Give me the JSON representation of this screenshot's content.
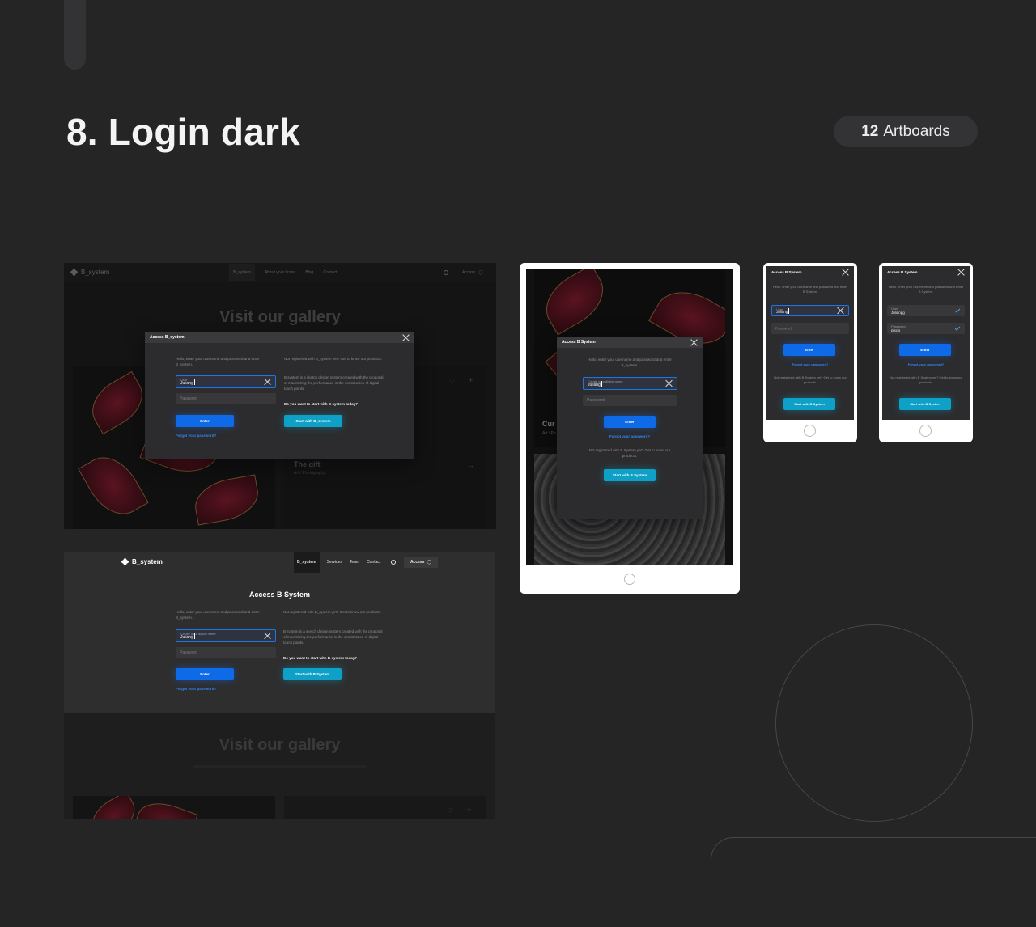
{
  "section": {
    "title": "8. Login dark",
    "badge_count": "12",
    "badge_text": "Artboards"
  },
  "colors": {
    "background": "#252526",
    "primary_blue": "#0f6ae8",
    "teal": "#0ea0c6",
    "link": "#2f86f4"
  },
  "desktop_modal": {
    "brand": "B_system",
    "nav": [
      "B_system",
      "About your brand",
      "Blog",
      "Contact"
    ],
    "nav_access": "Access",
    "hero": "Visit our gallery",
    "card_title": "The gift",
    "card_subtitle": "Art / Photography",
    "modal": {
      "title": "Access B_system",
      "intro": "Hello, enter your username and password and enter B_system.",
      "user_label": "User",
      "user_value": "Juliang",
      "password_placeholder": "Password",
      "enter": "Enter",
      "forgot": "Forgot your password?",
      "register": "Not registered with B_system yet? Get to know our products.",
      "about": "B system is a sketch design system created with the proposal of maximizing the performance in the construction of digital touch points.",
      "question": "Do you want to start with B-system today?",
      "start": "Start with B_system"
    }
  },
  "desktop_page": {
    "brand": "B_system",
    "nav": [
      "B_system",
      "Services",
      "Team",
      "Contact"
    ],
    "nav_access": "Access",
    "title": "Access B System",
    "intro": "Hello, enter your username and password and enter B_system.",
    "user_label": "Create your digital name",
    "user_value": "Juliang",
    "password_placeholder": "Password",
    "enter": "Enter",
    "forgot": "Forgot your password?",
    "register": "Not registered with B_system yet? Get to know our products.",
    "about": "B system is a sketch design system created with the proposal of maximizing the performance in the construction of digital touch points.",
    "question": "Do you want to start with B-system today?",
    "start": "Start with B System",
    "hero": "Visit our gallery"
  },
  "tablet": {
    "card_title": "Cur",
    "card_subtitle": "Art / Ph",
    "modal": {
      "title": "Access B System",
      "intro": "Hello, enter your username and password and enter B_system.",
      "user_label": "Create your digital name",
      "user_value": "Juliang",
      "password_placeholder": "Password",
      "enter": "Enter",
      "forgot": "Forgot your password?",
      "register": "Not registered with B System yet? Get to know our products.",
      "start": "Start with B System"
    }
  },
  "phone1": {
    "title": "Access B System",
    "intro": "Hello, enter your username and password and enter B System.",
    "user_label": "User",
    "user_value": "Juliang",
    "password_placeholder": "Password",
    "enter": "Enter",
    "forgot": "Forgot your password?",
    "register": "Not registered with B System yet? Get to know our products.",
    "start": "Start with B System"
  },
  "phone2": {
    "title": "Access B System",
    "intro": "Hello, enter your username and password and enter B System.",
    "user_label": "User",
    "user_value": "Julianpg",
    "password_label": "Password",
    "password_value": "piscis",
    "enter": "Enter",
    "forgot": "Forgot your password?",
    "register": "Not registered with B System yet? Get to know our products.",
    "start": "Start with B System"
  }
}
